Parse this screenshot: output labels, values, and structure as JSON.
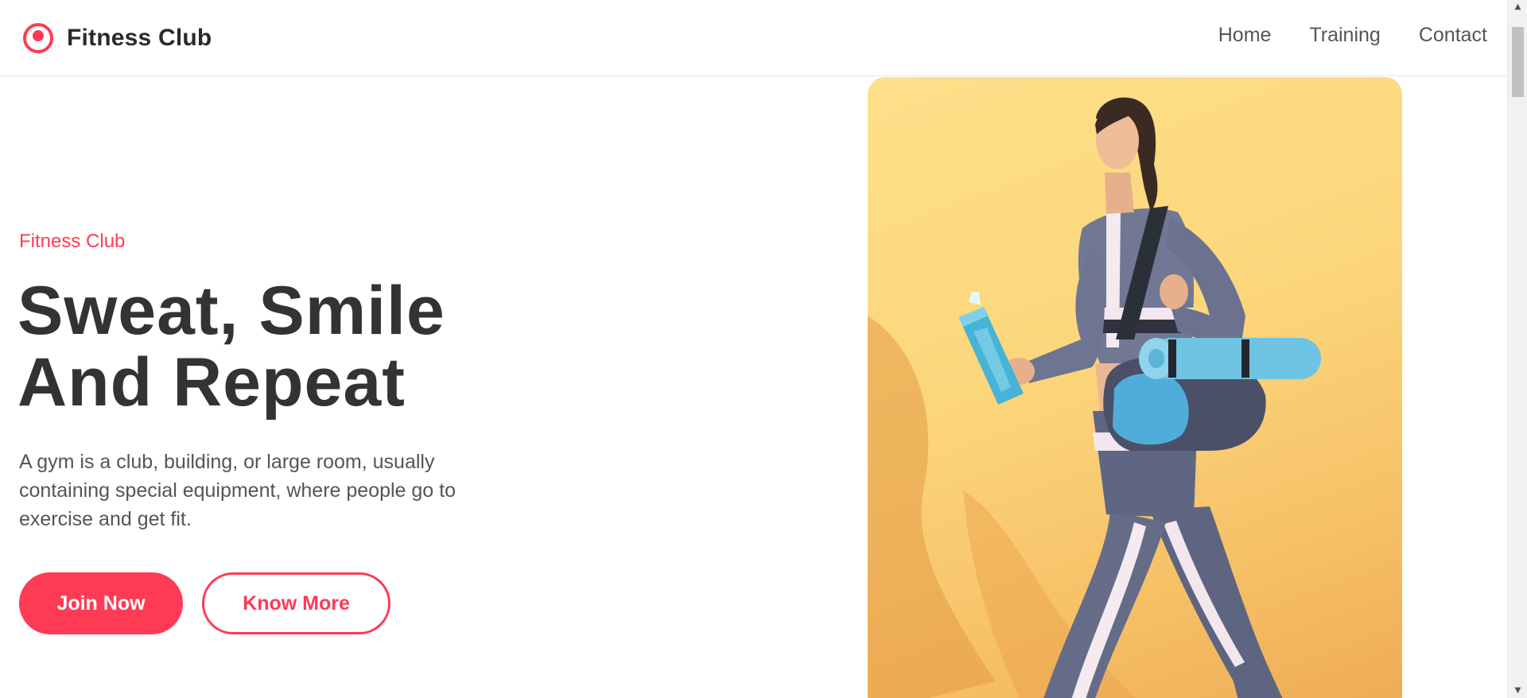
{
  "navbar": {
    "brand_name": "Fitness Club",
    "links": [
      "Home",
      "Training",
      "Contact"
    ]
  },
  "hero": {
    "eyebrow": "Fitness Club",
    "title_line1": "Sweat, Smile",
    "title_line2": "And Repeat",
    "description": "A gym is a club, building, or large room, usually containing special equipment, where people go to exercise and get fit.",
    "primary_button": "Join Now",
    "secondary_button": "Know More",
    "image_icon": "woman-with-yoga-mat-photo"
  },
  "colors": {
    "accent": "#ff3a55",
    "heading": "#333333",
    "body_text": "#555555",
    "image_background": "#fcd57a"
  },
  "scrollbar": {
    "up_icon": "triangle-up-icon",
    "down_icon": "triangle-down-icon"
  }
}
